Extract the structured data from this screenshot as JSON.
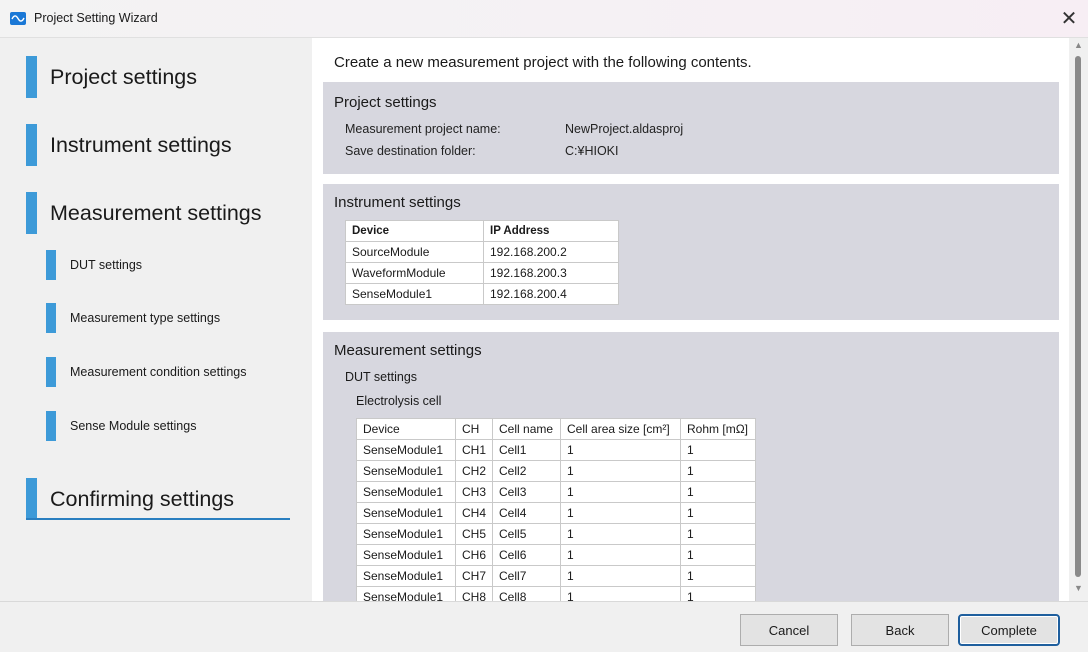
{
  "window": {
    "title": "Project Setting Wizard",
    "close_glyph": "✕"
  },
  "nav": {
    "items": [
      {
        "label": "Project settings"
      },
      {
        "label": "Instrument settings"
      },
      {
        "label": "Measurement settings"
      },
      {
        "label": "Confirming settings"
      }
    ],
    "sub_items": [
      {
        "label": "DUT settings"
      },
      {
        "label": "Measurement type settings"
      },
      {
        "label": "Measurement condition settings"
      },
      {
        "label": "Sense Module settings"
      }
    ],
    "accent_color": "#3d9ad8"
  },
  "intro": "Create a new measurement project with the following contents.",
  "project_settings": {
    "title": "Project settings",
    "name_label": "Measurement project name:",
    "name_value": "NewProject.aldasproj",
    "folder_label": "Save destination folder:",
    "folder_value": "C:¥HIOKI"
  },
  "instrument_settings": {
    "title": "Instrument settings",
    "columns": [
      "Device",
      "IP Address"
    ],
    "rows": [
      [
        "SourceModule",
        "192.168.200.2"
      ],
      [
        "WaveformModule",
        "192.168.200.3"
      ],
      [
        "SenseModule1",
        "192.168.200.4"
      ]
    ]
  },
  "measurement_settings": {
    "title": "Measurement settings",
    "dut_heading": "DUT settings",
    "cell_heading": "Electrolysis cell",
    "columns": [
      "Device",
      "CH",
      "Cell name",
      "Cell area size [cm²]",
      "Rohm [mΩ]"
    ],
    "rows": [
      [
        "SenseModule1",
        "CH1",
        "Cell1",
        "1",
        "1"
      ],
      [
        "SenseModule1",
        "CH2",
        "Cell2",
        "1",
        "1"
      ],
      [
        "SenseModule1",
        "CH3",
        "Cell3",
        "1",
        "1"
      ],
      [
        "SenseModule1",
        "CH4",
        "Cell4",
        "1",
        "1"
      ],
      [
        "SenseModule1",
        "CH5",
        "Cell5",
        "1",
        "1"
      ],
      [
        "SenseModule1",
        "CH6",
        "Cell6",
        "1",
        "1"
      ],
      [
        "SenseModule1",
        "CH7",
        "Cell7",
        "1",
        "1"
      ],
      [
        "SenseModule1",
        "CH8",
        "Cell8",
        "1",
        "1"
      ]
    ]
  },
  "footer": {
    "cancel_label": "Cancel",
    "back_label": "Back",
    "complete_label": "Complete"
  }
}
